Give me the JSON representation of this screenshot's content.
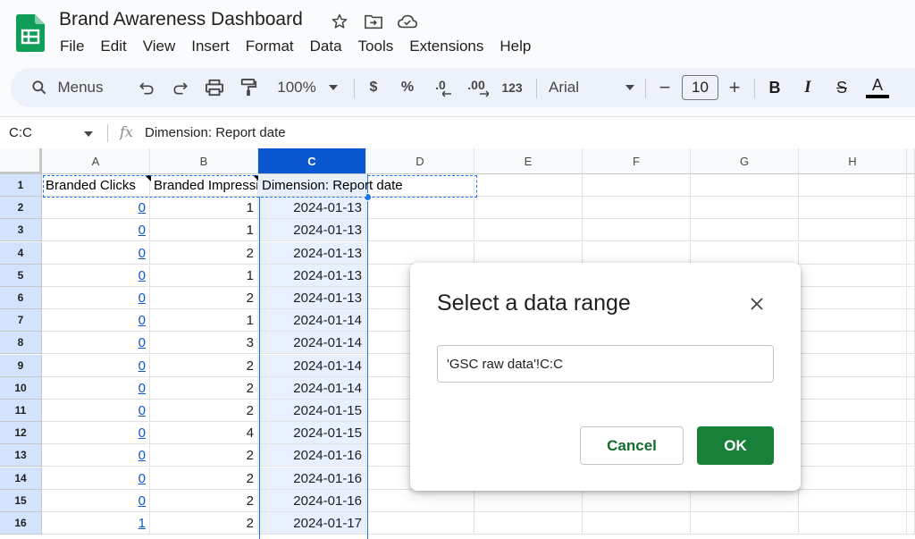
{
  "app": {
    "title": "Brand Awareness Dashboard",
    "logo_icon": "google-sheets-logo",
    "brand_color": "#0f9d58"
  },
  "menu": [
    "File",
    "Edit",
    "View",
    "Insert",
    "Format",
    "Data",
    "Tools",
    "Extensions",
    "Help"
  ],
  "toolbar": {
    "menus_label": "Menus",
    "zoom": "100%",
    "currency": "$",
    "percent": "%",
    "decrease_decimal": ".0",
    "increase_decimal": ".00",
    "number_format": "123",
    "font": "Arial",
    "font_size": "10",
    "minus": "−",
    "plus": "+",
    "bold": "B",
    "italic": "I",
    "strikethrough": "S",
    "text_color": "A"
  },
  "formula_bar": {
    "name_box": "C:C",
    "fx": "fx",
    "formula": "Dimension: Report date"
  },
  "grid": {
    "columns": [
      "A",
      "B",
      "C",
      "D",
      "E",
      "F",
      "G",
      "H"
    ],
    "selected_column": "C",
    "rows": [
      {
        "num": "1",
        "a": "Branded Clicks",
        "b": "Branded Impressions",
        "c": "Dimension: Report date"
      },
      {
        "num": "2",
        "a": "0",
        "b": "1",
        "c": "2024-01-13"
      },
      {
        "num": "3",
        "a": "0",
        "b": "1",
        "c": "2024-01-13"
      },
      {
        "num": "4",
        "a": "0",
        "b": "2",
        "c": "2024-01-13"
      },
      {
        "num": "5",
        "a": "0",
        "b": "1",
        "c": "2024-01-13"
      },
      {
        "num": "6",
        "a": "0",
        "b": "2",
        "c": "2024-01-13"
      },
      {
        "num": "7",
        "a": "0",
        "b": "1",
        "c": "2024-01-14"
      },
      {
        "num": "8",
        "a": "0",
        "b": "3",
        "c": "2024-01-14"
      },
      {
        "num": "9",
        "a": "0",
        "b": "2",
        "c": "2024-01-14"
      },
      {
        "num": "10",
        "a": "0",
        "b": "2",
        "c": "2024-01-14"
      },
      {
        "num": "11",
        "a": "0",
        "b": "2",
        "c": "2024-01-15"
      },
      {
        "num": "12",
        "a": "0",
        "b": "4",
        "c": "2024-01-15"
      },
      {
        "num": "13",
        "a": "0",
        "b": "2",
        "c": "2024-01-16"
      },
      {
        "num": "14",
        "a": "0",
        "b": "2",
        "c": "2024-01-16"
      },
      {
        "num": "15",
        "a": "0",
        "b": "2",
        "c": "2024-01-16"
      },
      {
        "num": "16",
        "a": "1",
        "b": "2",
        "c": "2024-01-17"
      }
    ]
  },
  "dialog": {
    "title": "Select a data range",
    "range_value": "'GSC raw data'!C:C",
    "cancel_label": "Cancel",
    "ok_label": "OK",
    "accent_color": "#188038"
  }
}
